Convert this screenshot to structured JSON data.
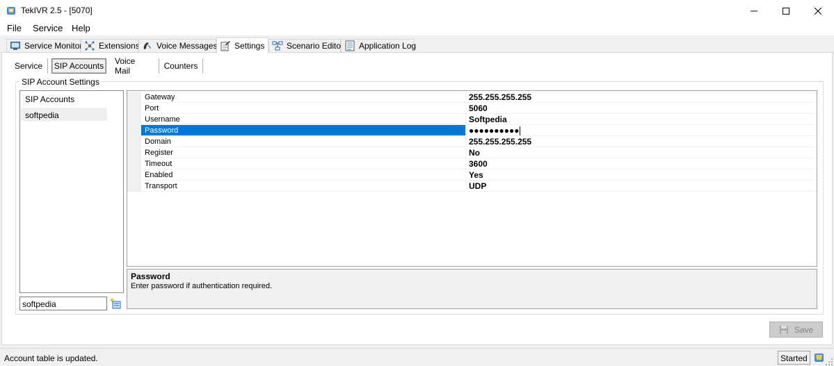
{
  "window": {
    "title": "TekIVR 2.5 - [5070]",
    "app_icon": "tekivr-app-icon"
  },
  "menu": [
    "File",
    "Service",
    "Help"
  ],
  "main_tabs": [
    {
      "label": "Service Monitor",
      "icon": "monitor-icon"
    },
    {
      "label": "Extensions",
      "icon": "extensions-network-icon"
    },
    {
      "label": "Voice Messages",
      "icon": "voice-messages-icon"
    },
    {
      "label": "Settings",
      "icon": "settings-checklist-icon",
      "active": true
    },
    {
      "label": "Scenario Editor",
      "icon": "scenario-flow-icon"
    },
    {
      "label": "Application Log",
      "icon": "log-notepad-icon"
    }
  ],
  "sub_tabs": [
    {
      "label": "Service"
    },
    {
      "label": "SIP Accounts",
      "active": true
    },
    {
      "label": "Voice Mail"
    },
    {
      "label": "Counters"
    }
  ],
  "group": {
    "title": "SIP Account Settings",
    "list_header": "SIP Accounts",
    "accounts": [
      "softpedia"
    ],
    "name_input_value": "softpedia"
  },
  "properties": [
    {
      "name": "Gateway",
      "value": "255.255.255.255"
    },
    {
      "name": "Port",
      "value": "5060"
    },
    {
      "name": "Username",
      "value": "Softpedia"
    },
    {
      "name": "Password",
      "value": "●●●●●●●●●●",
      "selected": true
    },
    {
      "name": "Domain",
      "value": "255.255.255.255"
    },
    {
      "name": "Register",
      "value": "No"
    },
    {
      "name": "Timeout",
      "value": "3600"
    },
    {
      "name": "Enabled",
      "value": "Yes"
    },
    {
      "name": "Transport",
      "value": "UDP"
    }
  ],
  "help": {
    "title": "Password",
    "description": "Enter password if authentication required."
  },
  "save_label": "Save",
  "status": {
    "message": "Account table is updated.",
    "state": "Started"
  },
  "colors": {
    "selection": "#0078d7",
    "window_bg": "#f0f0f0",
    "panel_bg": "#ffffff"
  }
}
